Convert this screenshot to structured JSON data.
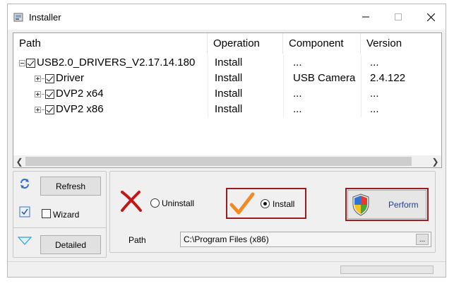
{
  "window": {
    "title": "Installer"
  },
  "tree": {
    "columns": [
      "Path",
      "Operation",
      "Component",
      "Version"
    ],
    "rows": [
      {
        "name": "USB2.0_DRIVERS_V2.17.14.180",
        "operation": "Install",
        "component": "...",
        "version": "...",
        "expander": "minus",
        "checked": true
      },
      {
        "name": "Driver",
        "operation": "Install",
        "component": "USB Camera",
        "version": "2.4.122",
        "expander": "plus",
        "checked": true
      },
      {
        "name": "DVP2 x64",
        "operation": "Install",
        "component": "...",
        "version": "...",
        "expander": "plus",
        "checked": true
      },
      {
        "name": "DVP2 x86",
        "operation": "Install",
        "component": "...",
        "version": "...",
        "expander": "plus",
        "checked": true
      }
    ]
  },
  "controls": {
    "refresh_label": "Refresh",
    "wizard_label": "Wizard",
    "wizard_checked": false,
    "detailed_label": "Detailed",
    "uninstall_label": "Uninstall",
    "install_label": "Install",
    "selected_operation": "Install",
    "perform_label": "Perform",
    "path_label": "Path",
    "path_value": "C:\\Program Files (x86)",
    "browse_label": "..."
  },
  "status": {
    "progress_fraction": 0
  },
  "icons": {
    "app": "installer-icon",
    "refresh": "refresh-arrows-icon",
    "wizard": "checkbox-icon",
    "detailed": "triangle-down-icon",
    "uninstall": "red-x-icon",
    "install": "orange-check-icon",
    "perform": "uac-shield-icon"
  },
  "colors": {
    "highlight": "#9b1c1c",
    "perform_text": "#1f3f9f",
    "check": "#f08a24",
    "cross": "#c01818"
  }
}
